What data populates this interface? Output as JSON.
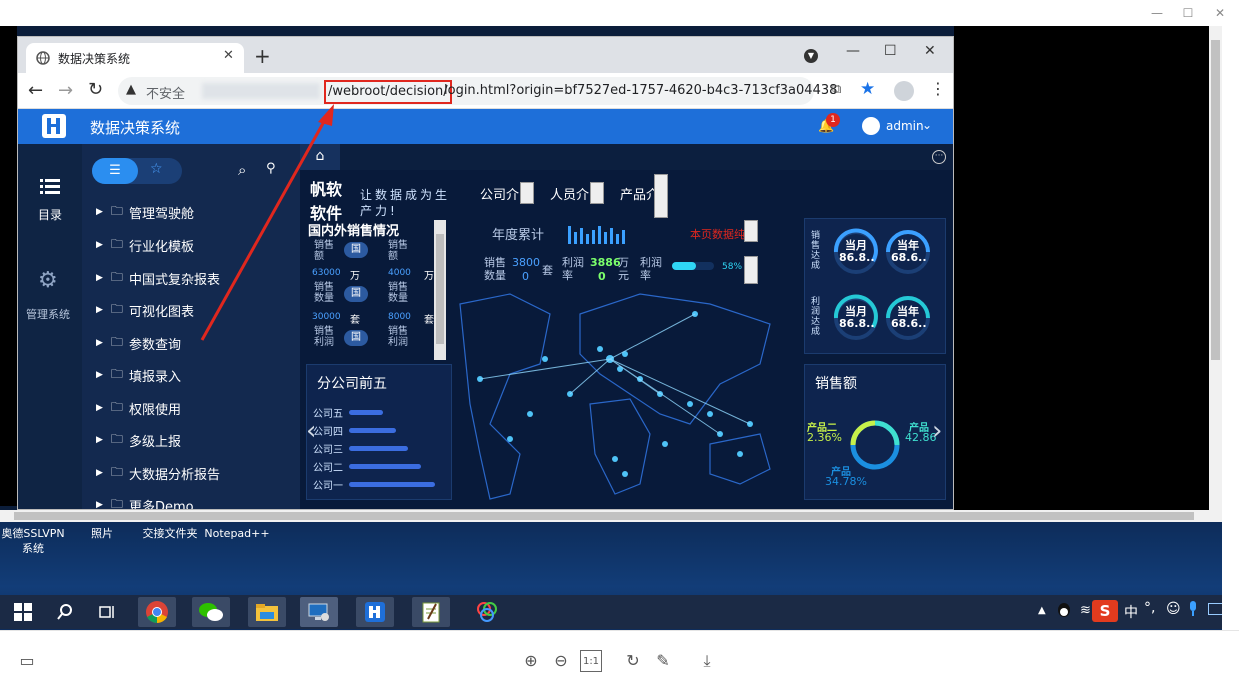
{
  "viewer": {
    "controls": [
      "—",
      "☐",
      "✕"
    ]
  },
  "browser": {
    "tab_title": "数据决策系统",
    "new_tab": "+",
    "window_controls": [
      "—",
      "☐",
      "✕"
    ],
    "security_label": "不安全",
    "url_highlight": "/webroot/decision/",
    "url_rest": "login.html?origin=bf7527ed-1757-4620-b4c3-713cf3a04438"
  },
  "app": {
    "title": "数据决策系统",
    "notification_count": "1",
    "user": "admin",
    "nav": [
      {
        "label": "目录",
        "icon": "list-icon"
      },
      {
        "label": "管理系统",
        "icon": "gear-icon"
      }
    ],
    "menu_items": [
      "管理驾驶舱",
      "行业化模板",
      "中国式复杂报表",
      "可视化图表",
      "参数查询",
      "填报录入",
      "权限使用",
      "多级上报",
      "大数据分析报告",
      "更多Demo"
    ]
  },
  "dashboard": {
    "brand1": "帆软",
    "brand2": "软件",
    "slogan1": "让数据成为生",
    "slogan2": "产力!",
    "tabs": [
      "公司介",
      "人员介",
      "产品介"
    ],
    "domestic_title": "国内外销售情况",
    "domestic_labels": [
      "销售额",
      "销售额",
      "销售数量",
      "销售数量",
      "销售利润",
      "销售利润"
    ],
    "domestic_btn": "国",
    "domestic_values": [
      "63000",
      "4000",
      "30000",
      "8000"
    ],
    "domestic_units": [
      "万",
      "万",
      "套",
      "套"
    ],
    "year_total": "年度累计",
    "page_data": "本页数据纯",
    "sales_qty_label": "销售数量",
    "sales_qty_value": "3800",
    "sales_qty_sub": "0",
    "sales_qty_unit": "套",
    "profit_label": "利润率",
    "profit_value": "3886",
    "profit_sub": "0",
    "profit_unit": "万元",
    "profit_rate_label": "利润率",
    "profit_rate_pct": "58%",
    "gauges": [
      {
        "label": "当月",
        "value": "86.8.."
      },
      {
        "label": "当年",
        "value": "68.6.."
      },
      {
        "label": "当月",
        "value": "86.8.."
      },
      {
        "label": "当年",
        "value": "68.6.."
      }
    ],
    "side_label1": "销售达成",
    "side_label2": "利润达成",
    "branch_title": "分公司前五",
    "branches": [
      "公司五",
      "公司四",
      "公司三",
      "公司二",
      "公司一"
    ],
    "branch_values": [
      0.38,
      0.52,
      0.66,
      0.8,
      0.95
    ],
    "sales_title": "销售额",
    "donut": [
      {
        "name": "产品二",
        "pct": "2.36%"
      },
      {
        "name": "产品",
        "pct": "42.86"
      },
      {
        "name": "产品",
        "pct": "34.78%"
      }
    ]
  },
  "desktop": {
    "icons": [
      "奥德SSLVPN系统",
      "照片",
      "交接文件夹",
      "Notepad++"
    ],
    "tray_ime": "中"
  },
  "colors": {
    "app_blue": "#1e6fd9",
    "highlight_red": "#e0271e",
    "dash_bg": "#081a3a"
  }
}
